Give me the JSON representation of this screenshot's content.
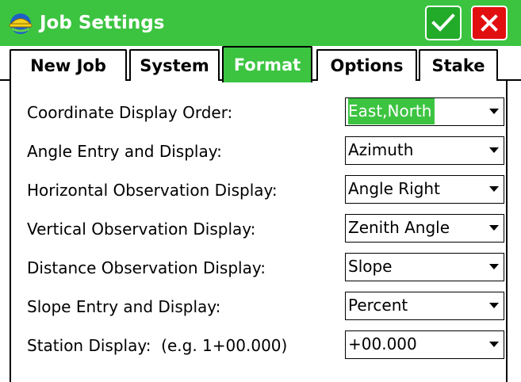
{
  "window": {
    "title": "Job Settings",
    "accent": "#3cc441",
    "ok_icon": "check-icon",
    "close_icon": "close-icon"
  },
  "tabs": [
    {
      "label": "New Job",
      "active": false
    },
    {
      "label": "System",
      "active": false
    },
    {
      "label": "Format",
      "active": true
    },
    {
      "label": "Options",
      "active": false
    },
    {
      "label": "Stake",
      "active": false
    }
  ],
  "settings": [
    {
      "label": "Coordinate Display Order:",
      "value": "East,North"
    },
    {
      "label": "Angle Entry and Display:",
      "value": "Azimuth"
    },
    {
      "label": "Horizontal Observation Display:",
      "value": "Angle Right"
    },
    {
      "label": "Vertical Observation Display:",
      "value": "Zenith Angle"
    },
    {
      "label": "Distance Observation Display:",
      "value": "Slope"
    },
    {
      "label": "Slope Entry and Display:",
      "value": "Percent"
    },
    {
      "label": "Station Display:  (e.g. 1+00.000)",
      "value": "+00.000"
    }
  ]
}
